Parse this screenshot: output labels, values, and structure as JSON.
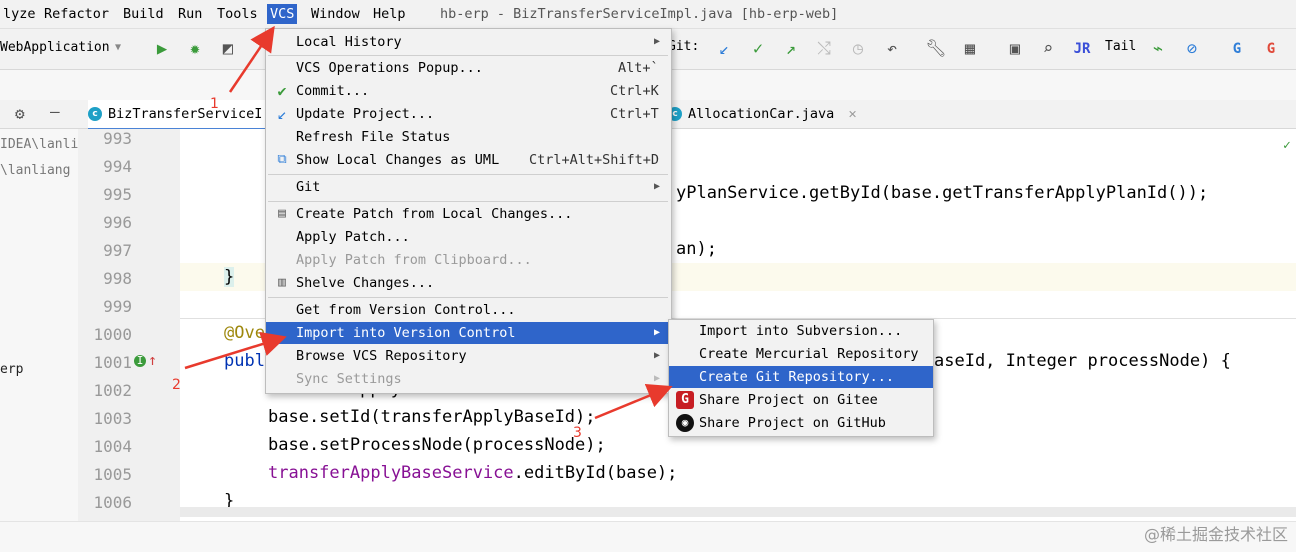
{
  "window_title": "hb-erp - BizTransferServiceImpl.java [hb-erp-web]",
  "menubar": [
    "lyze",
    "Refactor",
    "Build",
    "Run",
    "Tools",
    "VCS",
    "Window",
    "Help"
  ],
  "toolbar": {
    "run_config": "WebApplication",
    "git_label": "Git:",
    "tail_label": "Tail"
  },
  "tabs": {
    "left": "BizTransferServiceI",
    "right": "AllocationCar.java"
  },
  "project_panel": {
    "path1": "IDEA\\lanlia",
    "path2": "\\lanliang",
    "item": "erp"
  },
  "line_numbers": [
    "993",
    "994",
    "995",
    "996",
    "997",
    "998",
    "999",
    "1000",
    "1001",
    "1002",
    "1003",
    "1004",
    "1005",
    "1006"
  ],
  "code": {
    "l995": "yPlanService.getById(base.getTransferApplyPlanId());",
    "l997": "an);",
    "l998": "}",
    "l1000": "@Ove",
    "l1001_a": "publ",
    "l1001_b": "aseId, Integer processNode) {",
    "l1002": "TransferApplyBase base = new Transf",
    "l1003": "base.setId(transferApplyBaseId);",
    "l1004": "base.setProcessNode(processNode);",
    "l1005_field": "transferApplyBaseService",
    "l1005_rest": ".editById(base);",
    "l1006": "}"
  },
  "vcs_menu": {
    "items": [
      {
        "label": "Local History",
        "submenu": true
      },
      {
        "label": "VCS Operations Popup...",
        "shortcut": "Alt+`"
      },
      {
        "label": "Commit...",
        "shortcut": "Ctrl+K",
        "icon": "check-icon"
      },
      {
        "label": "Update Project...",
        "shortcut": "Ctrl+T",
        "icon": "update-arrow-icon"
      },
      {
        "label": "Refresh File Status"
      },
      {
        "label": "Show Local Changes as UML",
        "shortcut": "Ctrl+Alt+Shift+D",
        "icon": "uml-icon"
      },
      {
        "label": "Git",
        "submenu": true
      },
      {
        "label": "Create Patch from Local Changes...",
        "icon": "patch-icon"
      },
      {
        "label": "Apply Patch..."
      },
      {
        "label": "Apply Patch from Clipboard...",
        "disabled": true
      },
      {
        "label": "Shelve Changes...",
        "icon": "shelve-icon"
      },
      {
        "label": "Get from Version Control..."
      },
      {
        "label": "Import into Version Control",
        "submenu": true,
        "selected": true
      },
      {
        "label": "Browse VCS Repository",
        "submenu": true
      },
      {
        "label": "Sync Settings",
        "submenu": true,
        "disabled": true
      }
    ]
  },
  "import_submenu": {
    "items": [
      {
        "label": "Import into Subversion..."
      },
      {
        "label": "Create Mercurial Repository"
      },
      {
        "label": "Create Git Repository...",
        "selected": true
      },
      {
        "label": "Share Project on Gitee",
        "icon": "gitee-icon"
      },
      {
        "label": "Share Project on GitHub",
        "icon": "github-icon"
      }
    ]
  },
  "annotations": {
    "step1": "1",
    "step2": "2",
    "step3": "3"
  },
  "watermark": "@稀土掘金技术社区",
  "colors": {
    "accent": "#2f65ca",
    "annotation": "#e83a2d",
    "class_icon": "#1ea0c6"
  }
}
